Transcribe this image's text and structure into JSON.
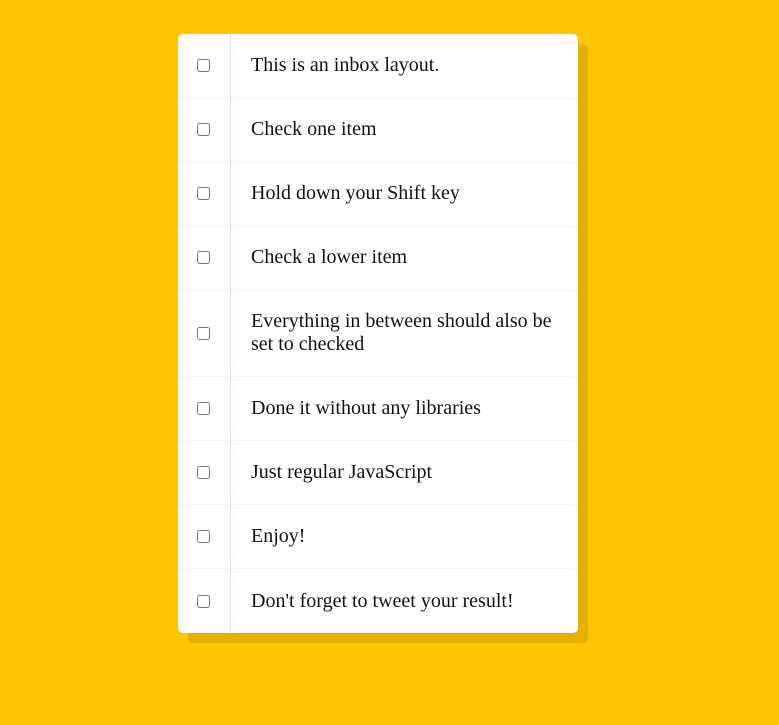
{
  "colors": {
    "background": "#ffc600",
    "panel": "#ffffff",
    "divider": "#d1e2ff"
  },
  "inbox": {
    "items": [
      {
        "label": "This is an inbox layout.",
        "checked": false
      },
      {
        "label": "Check one item",
        "checked": false
      },
      {
        "label": "Hold down your Shift key",
        "checked": false
      },
      {
        "label": "Check a lower item",
        "checked": false
      },
      {
        "label": "Everything in between should also be set to checked",
        "checked": false
      },
      {
        "label": "Done it without any libraries",
        "checked": false
      },
      {
        "label": "Just regular JavaScript",
        "checked": false
      },
      {
        "label": "Enjoy!",
        "checked": false
      },
      {
        "label": "Don't forget to tweet your result!",
        "checked": false
      }
    ]
  }
}
